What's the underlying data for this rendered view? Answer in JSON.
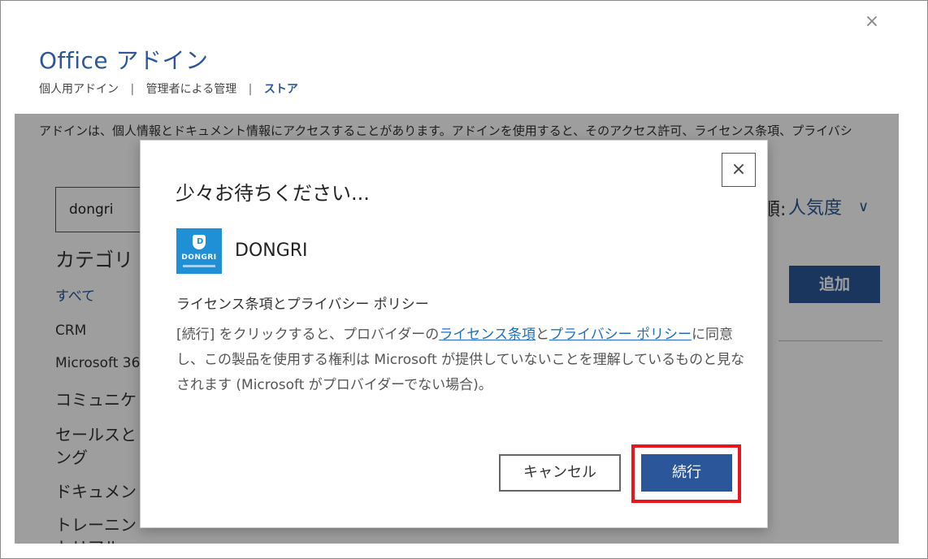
{
  "window": {
    "title": "Office アドイン",
    "close_glyph": "×"
  },
  "breadcrumbs": [
    {
      "label": "個人用アドイン",
      "active": false
    },
    {
      "label": "管理者による管理",
      "active": false
    },
    {
      "label": "ストア",
      "active": true
    }
  ],
  "breadcrumb_separator": "|",
  "background": {
    "notice": "アドインは、個人情報とドキュメント情報にアクセスすることがあります。アドインを使用すると、そのアクセス許可、ライセンス条項、プライバシ",
    "search_value": "dongri",
    "sort_label": "順:",
    "sort_value": "人気度",
    "sort_chevron": "∨",
    "category_heading": "カテゴリ",
    "categories": [
      "すべて",
      "CRM",
      "Microsoft 36",
      "コミュニケ",
      "セールスと",
      "ング",
      "ドキュメン",
      "トレーニン",
      "トリアル"
    ],
    "add_button": "追加"
  },
  "dialog": {
    "title": "少々お待ちください...",
    "close_glyph": "×",
    "app_name": "DONGRI",
    "logo_text": "DONGRI",
    "logo_letter": "D",
    "section_title": "ライセンス条項とプライバシー ポリシー",
    "terms_part1": "[続行] をクリックすると、プロバイダーの",
    "terms_link1": "ライセンス条項",
    "terms_and": "と",
    "terms_link2": "プライバシー ポリシー",
    "terms_part2": "に同意し、この製品を使用する権利は Microsoft が提供していないことを理解しているものと見なされます (Microsoft がプロバイダーでない場合)。",
    "cancel_label": "キャンセル",
    "continue_label": "続行"
  },
  "colors": {
    "accent": "#2b579a",
    "link": "#1f6fc0",
    "highlight": "#e8151a",
    "logo": "#1f8fd6"
  }
}
